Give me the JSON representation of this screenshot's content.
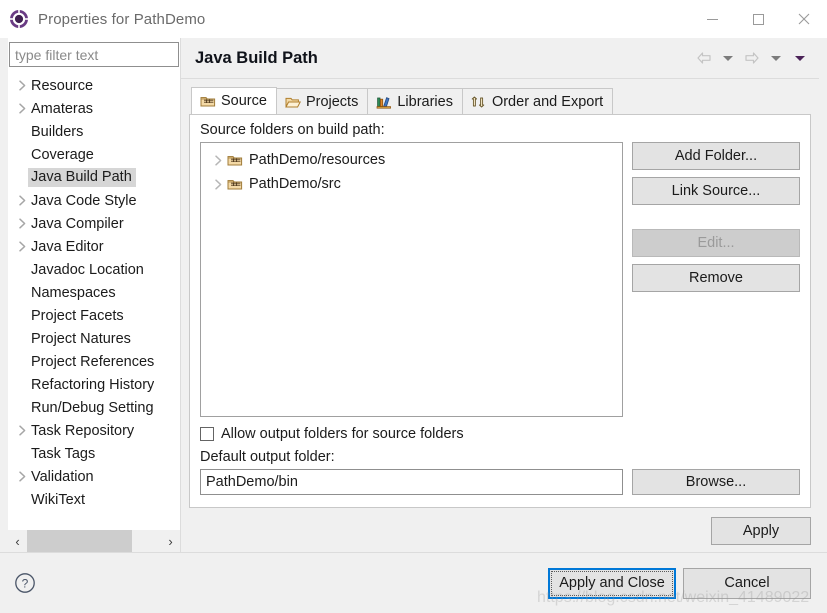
{
  "window": {
    "title": "Properties for PathDemo",
    "icon": "eclipse-properties-icon",
    "minimize_label": "Minimize",
    "maximize_label": "Maximize",
    "close_label": "Close"
  },
  "sidebar": {
    "filter": {
      "value": "",
      "placeholder": "type filter text"
    },
    "items": [
      {
        "label": "Resource",
        "expandable": true,
        "selected": false
      },
      {
        "label": "Amateras",
        "expandable": true,
        "selected": false
      },
      {
        "label": "Builders",
        "expandable": false,
        "selected": false
      },
      {
        "label": "Coverage",
        "expandable": false,
        "selected": false
      },
      {
        "label": "Java Build Path",
        "expandable": false,
        "selected": true
      },
      {
        "label": "Java Code Style",
        "expandable": true,
        "selected": false
      },
      {
        "label": "Java Compiler",
        "expandable": true,
        "selected": false
      },
      {
        "label": "Java Editor",
        "expandable": true,
        "selected": false
      },
      {
        "label": "Javadoc Location",
        "expandable": false,
        "selected": false
      },
      {
        "label": "Namespaces",
        "expandable": false,
        "selected": false
      },
      {
        "label": "Project Facets",
        "expandable": false,
        "selected": false
      },
      {
        "label": "Project Natures",
        "expandable": false,
        "selected": false
      },
      {
        "label": "Project References",
        "expandable": false,
        "selected": false
      },
      {
        "label": "Refactoring History",
        "expandable": false,
        "selected": false
      },
      {
        "label": "Run/Debug Setting",
        "expandable": false,
        "selected": false
      },
      {
        "label": "Task Repository",
        "expandable": true,
        "selected": false
      },
      {
        "label": "Task Tags",
        "expandable": false,
        "selected": false
      },
      {
        "label": "Validation",
        "expandable": true,
        "selected": false
      },
      {
        "label": "WikiText",
        "expandable": false,
        "selected": false
      }
    ],
    "scrollbar": {
      "left_arrow": "‹",
      "right_arrow": "›"
    }
  },
  "page": {
    "title": "Java Build Path",
    "nav": {
      "back": "back-arrow",
      "back_menu": "back-dropdown",
      "forward": "forward-arrow",
      "forward_menu": "forward-dropdown",
      "view_menu": "view-menu-dropdown"
    },
    "tabs": [
      {
        "label": "Source",
        "icon": "package-folder-icon",
        "active": true
      },
      {
        "label": "Projects",
        "icon": "open-folder-icon",
        "active": false
      },
      {
        "label": "Libraries",
        "icon": "books-icon",
        "active": false
      },
      {
        "label": "Order and Export",
        "icon": "arrows-icon",
        "active": false
      }
    ],
    "source": {
      "tree_label": "Source folders on build path:",
      "entries": [
        {
          "label": "PathDemo/resources",
          "icon": "package-folder-icon"
        },
        {
          "label": "PathDemo/src",
          "icon": "package-folder-icon"
        }
      ],
      "buttons": [
        {
          "label": "Add Folder...",
          "disabled": false
        },
        {
          "label": "Link Source...",
          "disabled": false
        },
        {
          "label": "Edit...",
          "disabled": true
        },
        {
          "label": "Remove",
          "disabled": false
        }
      ],
      "allow_output_checkbox": {
        "label": "Allow output folders for source folders",
        "checked": false
      },
      "default_output": {
        "label": "Default output folder:",
        "value": "PathDemo/bin",
        "browse_label": "Browse..."
      }
    },
    "apply_label": "Apply"
  },
  "footer": {
    "help_icon": "help-circle-icon",
    "primary_label": "Apply and Close",
    "cancel_label": "Cancel"
  },
  "watermark": "https://blog.csdn.net/weixin_41489022",
  "colors": {
    "accent": "#0078d7",
    "dialog_bg": "#f0f0f0",
    "panel_bg": "#ffffff",
    "selection": "#d6d6d6",
    "title_icon_purple": "#6a3b84"
  }
}
